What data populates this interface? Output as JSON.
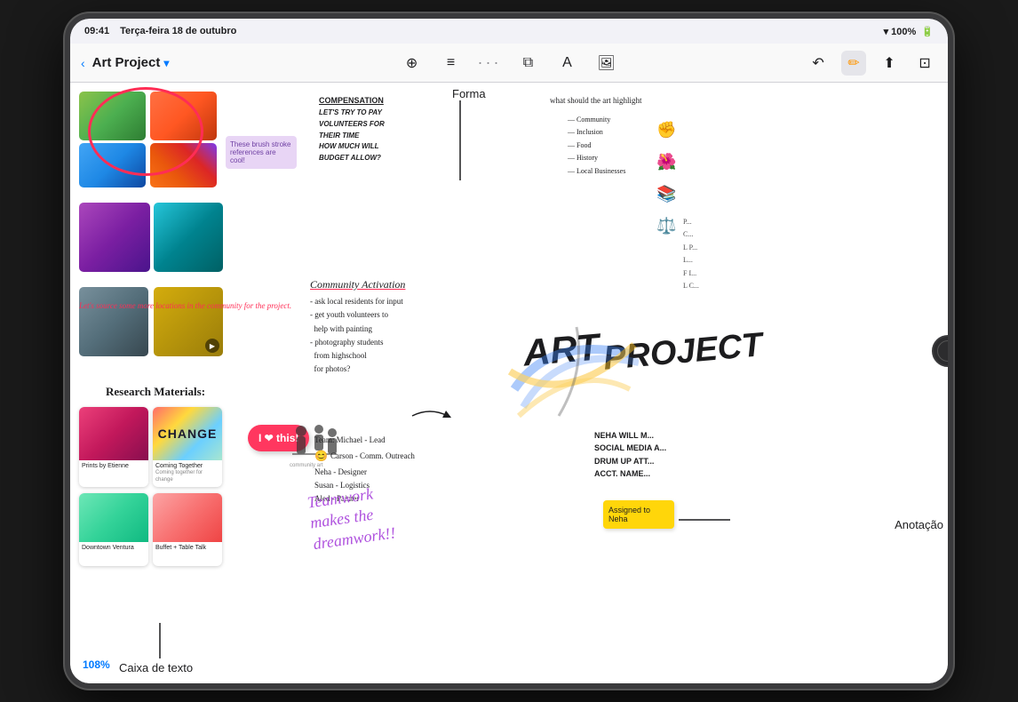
{
  "statusBar": {
    "time": "09:41",
    "date": "Terça-feira 18 de outubro",
    "wifi": "100%",
    "battery": "100%"
  },
  "toolbar": {
    "backLabel": "‹",
    "projectTitle": "Art Project",
    "dropdownIcon": "chevron-down",
    "dotsLabel": "···",
    "tools": [
      "antenna-icon",
      "align-icon",
      "layers-icon",
      "text-icon",
      "image-icon"
    ],
    "rightTools": [
      "undo-icon",
      "pen-icon",
      "share-icon",
      "edit-icon"
    ]
  },
  "canvas": {
    "zoomLevel": "108%",
    "labels": {
      "forma": "Forma",
      "anotacao": "Anotação",
      "caixaDeTexto": "Caixa de texto"
    },
    "stickyNote1": "I ❤\nthis!",
    "stickyNote2": "Assigned to\nNeha",
    "brushNote": "These brush\nstroke references\nare cool!",
    "pinkNote": "Let's source some\nmore locations in\nthe community for\nthe project.",
    "compensationTitle": "COMPENSATION",
    "compensationText": "LET'S TRY TO PAY\nVOLUNTEERS FOR\nTHEIR TIME\nHOW MUCH WILL\nBUDGET ALLOW?",
    "communityActivation": "Community Activation",
    "communityBullets": "- ask local residents for input\n- get youth volunteers to\nhelp with painting\n- photography students\nfrom highschool\nfor photos?",
    "teamText": "Team: Michael - Lead\n● Carson - Comm. Outreach\nNeha - Designer\nSusan - Logistics\nAled - Painter",
    "artProjectLabel1": "ART",
    "artProjectLabel2": "PROJECT",
    "researchMaterials": "Research Materials:",
    "teamworkText": "Teamwork\nmakes the\ndreamwork!!",
    "whatShouldText": "what should the art highlight",
    "communityList": "Community\nInclusion\nFood\nHistory\nLocal Businesses",
    "nehaText": "NEHA WILL M\nSOCIAL MEDIA A\nDRUM UP ATT\nACCT. NAME",
    "changeLabel": "CHANGE",
    "comingTogether": "Coming Together",
    "comingTogetherSub": "Coming together for change",
    "printsByEtienne": "Prints by Etienne",
    "downtownVentura": "Downtown Ventura",
    "buffetLabel": "Buffet + Table Talk"
  }
}
